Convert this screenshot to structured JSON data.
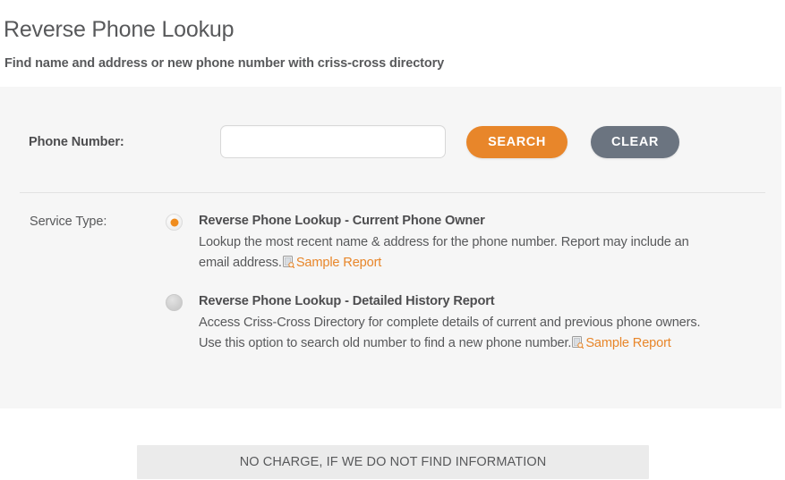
{
  "header": {
    "title": "Reverse Phone Lookup",
    "subtitle": "Find name and address or new phone number with criss-cross directory"
  },
  "form": {
    "phone_label": "Phone Number:",
    "phone_value": "",
    "phone_placeholder": "",
    "search_label": "SEARCH",
    "clear_label": "CLEAR",
    "service_type_label": "Service Type:",
    "options": [
      {
        "title": "Reverse Phone Lookup - Current Phone Owner",
        "description": "Lookup the most recent name & address for the phone number. Report may include an email address.",
        "link_label": "Sample Report",
        "link_icon": "document-search-icon",
        "selected": true
      },
      {
        "title": "Reverse Phone Lookup - Detailed History Report",
        "description": "Access Criss-Cross Directory for complete details of current and previous phone owners. Use this option to search old number to find a new phone number.",
        "link_label": "Sample Report",
        "link_icon": "document-search-icon",
        "selected": false
      }
    ]
  },
  "footer": {
    "no_charge_text": "NO CHARGE, IF WE DO NOT FIND INFORMATION"
  },
  "colors": {
    "accent_orange": "#e8862a",
    "clear_gray": "#6b7480",
    "panel_bg": "#f6f6f6",
    "bar_bg": "#ebebeb",
    "text": "#58595b"
  }
}
